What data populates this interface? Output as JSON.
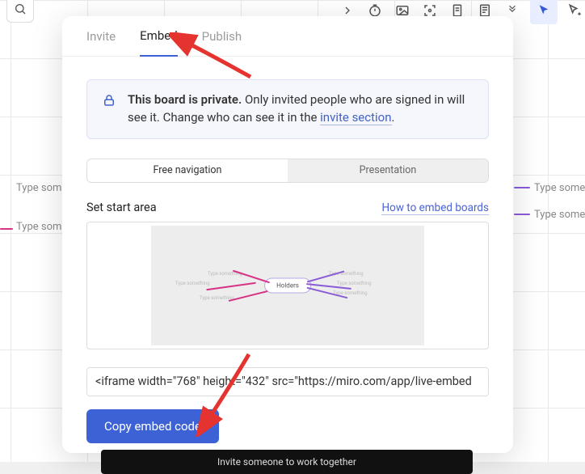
{
  "bg": {
    "placeholder_a": "Type some",
    "placeholder_b": "Type some",
    "placeholder_c": "Type some",
    "placeholder_d": "Type some"
  },
  "tabs": {
    "invite": "Invite",
    "embed": "Embed",
    "publish": "Publish"
  },
  "banner": {
    "bold": "This board is private.",
    "rest_a": " Only invited people who are signed in will see it. Change who can see it in the ",
    "link": "invite section",
    "rest_b": "."
  },
  "segmented": {
    "free": "Free navigation",
    "presentation": "Presentation"
  },
  "start_area": {
    "label": "Set start area",
    "help": "How to embed boards",
    "preview_center": "Holders"
  },
  "embed_code": {
    "value": "<iframe width=\"768\" height=\"432\" src=\"https://miro.com/app/live-embed"
  },
  "copy_button": "Copy embed code",
  "bottom_strip": "Invite someone to work together"
}
